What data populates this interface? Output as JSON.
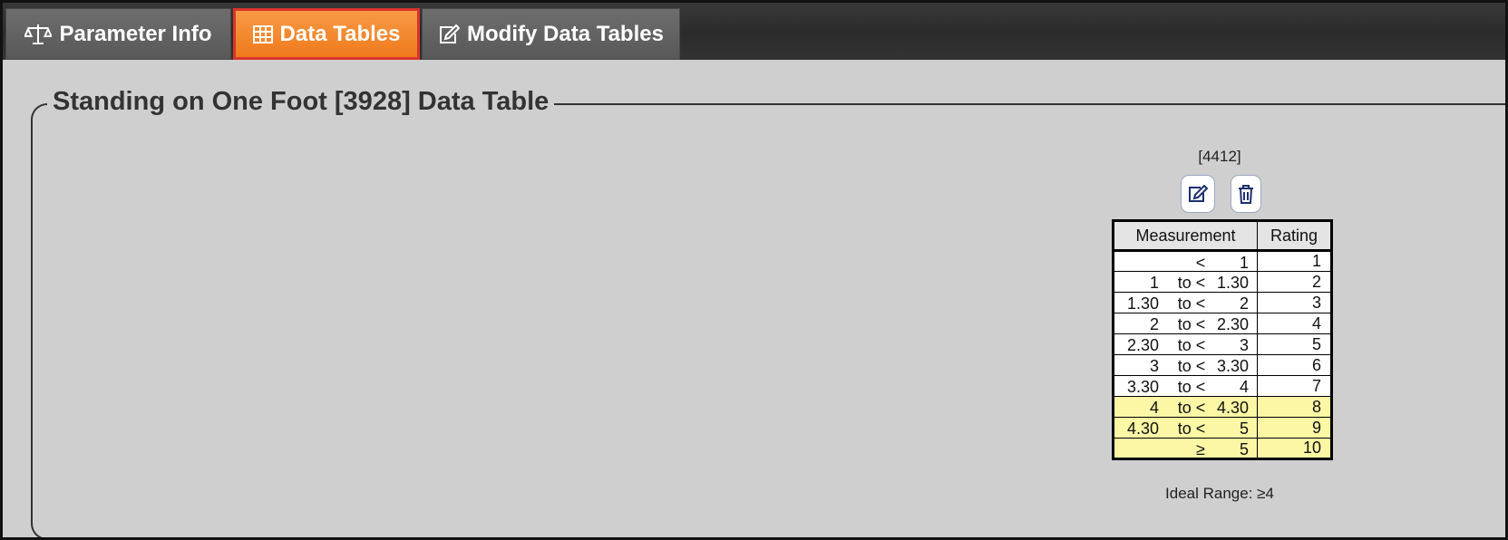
{
  "tabs": [
    {
      "label": "Parameter Info",
      "icon": "balance-scale-icon",
      "active": false
    },
    {
      "label": "Data Tables",
      "icon": "table-icon",
      "active": true
    },
    {
      "label": "Modify Data Tables",
      "icon": "edit-icon",
      "active": false
    }
  ],
  "colors": {
    "active_tab": "#f0821f",
    "active_tab_border": "#d9342b",
    "highlight_row": "#fbf7a5"
  },
  "section": {
    "title": "Standing on One Foot [3928] Data Table",
    "table_id": "[4412]",
    "actions": [
      {
        "name": "edit",
        "icon": "edit-icon"
      },
      {
        "name": "delete",
        "icon": "trash-icon"
      }
    ],
    "table": {
      "headers": [
        "Measurement",
        "Rating"
      ],
      "rows": [
        {
          "lo": "",
          "op": "<",
          "hi": "1",
          "rating": "1",
          "highlight": false
        },
        {
          "lo": "1",
          "op": "to <",
          "hi": "1.30",
          "rating": "2",
          "highlight": false
        },
        {
          "lo": "1.30",
          "op": "to <",
          "hi": "2",
          "rating": "3",
          "highlight": false
        },
        {
          "lo": "2",
          "op": "to <",
          "hi": "2.30",
          "rating": "4",
          "highlight": false
        },
        {
          "lo": "2.30",
          "op": "to <",
          "hi": "3",
          "rating": "5",
          "highlight": false
        },
        {
          "lo": "3",
          "op": "to <",
          "hi": "3.30",
          "rating": "6",
          "highlight": false
        },
        {
          "lo": "3.30",
          "op": "to <",
          "hi": "4",
          "rating": "7",
          "highlight": false
        },
        {
          "lo": "4",
          "op": "to <",
          "hi": "4.30",
          "rating": "8",
          "highlight": true
        },
        {
          "lo": "4.30",
          "op": "to <",
          "hi": "5",
          "rating": "9",
          "highlight": true
        },
        {
          "lo": "",
          "op": "≥",
          "hi": "5",
          "rating": "10",
          "highlight": true
        }
      ]
    },
    "ideal_range": "Ideal Range: ≥4"
  }
}
